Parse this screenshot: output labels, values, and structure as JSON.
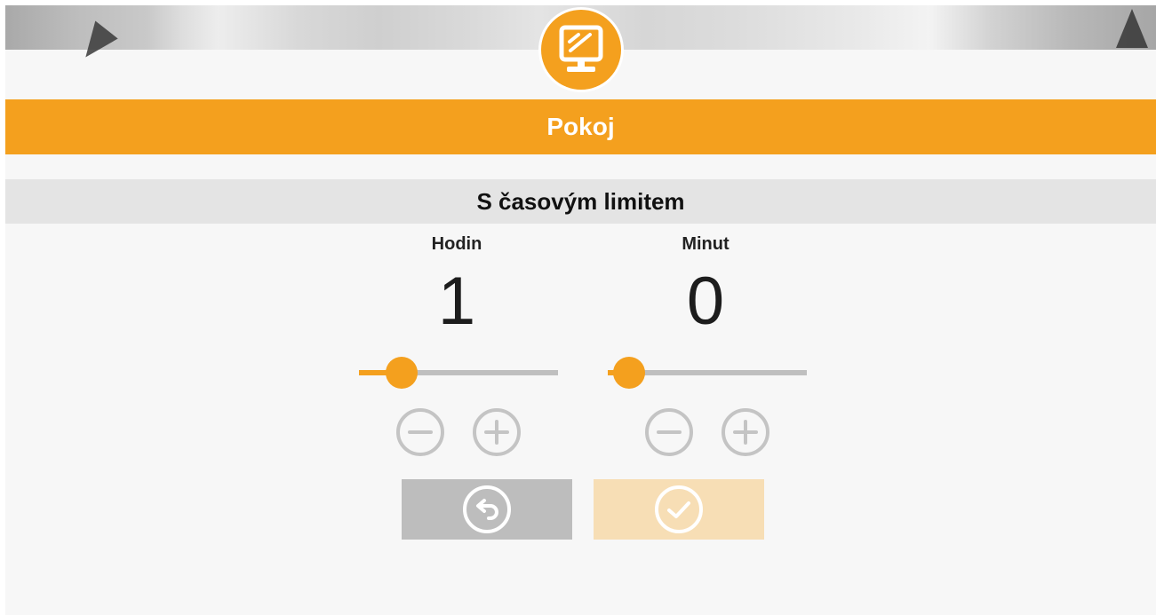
{
  "header": {
    "title": "Pokoj",
    "logo_icon": "monitor-icon"
  },
  "section": {
    "title": "S časovým limitem"
  },
  "timer": {
    "hours": {
      "label": "Hodin",
      "value": "1",
      "slider_fraction": 0.13,
      "minus_icon": "minus-circle-icon",
      "plus_icon": "plus-circle-icon"
    },
    "minutes": {
      "label": "Minut",
      "value": "0",
      "slider_fraction": 0.0,
      "minus_icon": "minus-circle-icon",
      "plus_icon": "plus-circle-icon"
    }
  },
  "actions": {
    "back_icon": "undo-icon",
    "confirm_icon": "check-circle-icon"
  },
  "colors": {
    "accent": "#f4a01e",
    "accent_light": "#f7deb5",
    "disabled": "#bdbdbd",
    "section_bg": "#e4e4e4",
    "page_bg": "#f7f7f7"
  }
}
